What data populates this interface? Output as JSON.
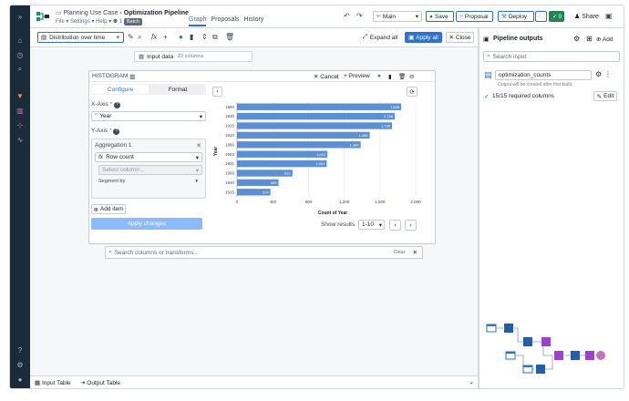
{
  "header": {
    "project": "Planning Use Case",
    "separator": "›",
    "pipeline": "Optimization Pipeline",
    "menu": [
      "File",
      "Settings",
      "Help"
    ],
    "count": "1",
    "batch": "Batch",
    "tabs": [
      "Graph",
      "Proposals",
      "History"
    ],
    "branch": "Main",
    "save": "Save",
    "proposal": "Proposal",
    "deploy": "Deploy",
    "checks": "0",
    "share": "Share"
  },
  "toolbar": {
    "selection": "Distribution over time",
    "expand_all": "Expand all",
    "apply_all": "Apply all",
    "close": "Close"
  },
  "input_node": {
    "label": "Input data",
    "columns": "22 columns"
  },
  "histogram": {
    "title": "HISTOGRAM",
    "cancel": "Cancel",
    "preview": "Preview",
    "tabs": [
      "Configure",
      "Format"
    ],
    "x_axis_label": "X-Axis",
    "x_axis_value": "Year",
    "y_axis_label": "Y-Axis",
    "aggregation_title": "Aggregation 1",
    "agg_fn": "Row count",
    "select_placeholder": "Select column...",
    "segment_by": "Segment by",
    "add_item": "Add item",
    "apply_changes": "Apply changes",
    "show_results": "Show results",
    "pager": "1-10"
  },
  "chart_data": {
    "type": "bar",
    "orientation": "horizontal",
    "categories": [
      "1920",
      "1930",
      "1925",
      "1910",
      "1880",
      "1903",
      "1931",
      "1960",
      "1940",
      "1915"
    ],
    "values": [
      1838,
      1766,
      1735,
      1486,
      1384,
      1012,
      1004,
      621,
      465,
      374
    ],
    "data_labels": [
      "1,838",
      "1,766",
      "1,735",
      "1,486",
      "1,384",
      "1,012",
      "1,004",
      "621",
      "465",
      "374"
    ],
    "xlabel": "Count of Year",
    "ylabel": "Year",
    "xlim": [
      0,
      2000
    ],
    "x_ticks": [
      "0",
      "400",
      "800",
      "1,200",
      "1,600",
      "2,000"
    ],
    "bar_color": "#5b8fd6",
    "grid": true
  },
  "search": {
    "placeholder": "Search columns or transforms...",
    "clear": "Clear"
  },
  "bottom_tabs": [
    "Input Table",
    "Output Table"
  ],
  "outputs": {
    "title": "Pipeline outputs",
    "add": "Add",
    "search_placeholder": "Search input",
    "output_name": "optimization_counts",
    "output_note": "Output will be created after first build.",
    "required": "15/15 required columns",
    "edit": "Edit"
  },
  "colors": {
    "accent": "#2d72d2",
    "success": "#238551",
    "rail": "#1c2b3a",
    "node_purple": "#9d3fd1",
    "node_blue": "#215db0"
  }
}
